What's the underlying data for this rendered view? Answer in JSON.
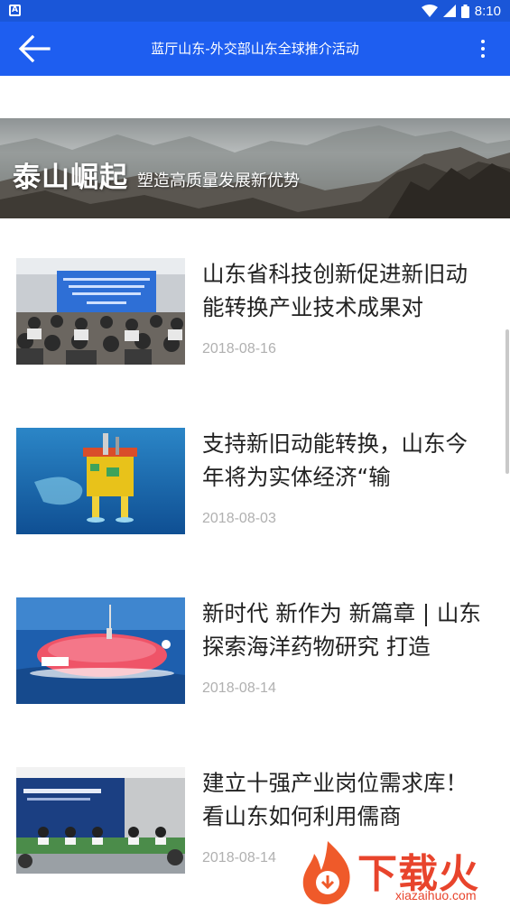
{
  "status_bar": {
    "time": "8:10",
    "app_icon_letter": "A",
    "icons": [
      "wifi-icon",
      "signal-icon",
      "battery-icon"
    ]
  },
  "app_bar": {
    "title": "蓝厅山东-外交部山东全球推介活动",
    "back_icon": "arrow-left-icon",
    "more_icon": "more-vertical-icon"
  },
  "banner": {
    "main_text": "泰山崛起",
    "sub_text": "塑造高质量发展新优势"
  },
  "news": [
    {
      "title": "山东省科技创新促进新旧动能转换产业技术成果对",
      "date": "2018-08-16",
      "thumb_desc": "conference-hall"
    },
    {
      "title": "支持新旧动能转换，山东今年将为实体经济“输",
      "date": "2018-08-03",
      "thumb_desc": "offshore-platform"
    },
    {
      "title": "新时代 新作为 新篇章 | 山东探索海洋药物研究 打造",
      "date": "2018-08-14",
      "thumb_desc": "submersible"
    },
    {
      "title": "建立十强产业岗位需求库！看山东如何利用儒商",
      "date": "2018-08-14",
      "thumb_desc": "press-conference"
    }
  ],
  "watermark": {
    "brand": "下载火",
    "url": "xiazaihuo.com"
  },
  "colors": {
    "status_bar": "#1a56d8",
    "app_bar": "#1e5ef0",
    "date_text": "#b0b0b0",
    "watermark": "#e8442c"
  }
}
